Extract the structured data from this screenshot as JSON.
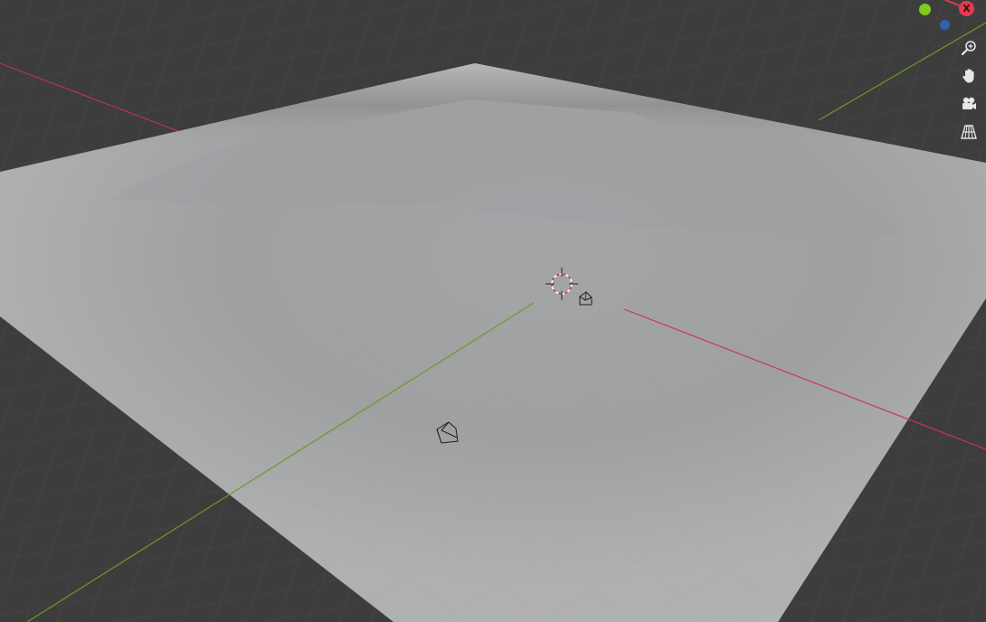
{
  "viewport": {
    "background_color": "#3d3d3d",
    "grid_color": "#4a4a4a",
    "plane_color": "#a8a9ab",
    "x_axis_color": "#c6394d",
    "y_axis_color": "#6c9b1f"
  },
  "gizmo": {
    "x_label": "X",
    "x_color": "#e8384f",
    "y_color": "#7fcb1e",
    "z_color": "#2f62ad"
  },
  "tools": [
    {
      "name": "zoom-icon"
    },
    {
      "name": "hand-pan-icon"
    },
    {
      "name": "camera-view-icon"
    },
    {
      "name": "perspective-grid-icon"
    }
  ],
  "scene_objects": [
    {
      "name": "3d-cursor-icon"
    },
    {
      "name": "light-object-icon"
    },
    {
      "name": "camera-object-icon"
    }
  ]
}
